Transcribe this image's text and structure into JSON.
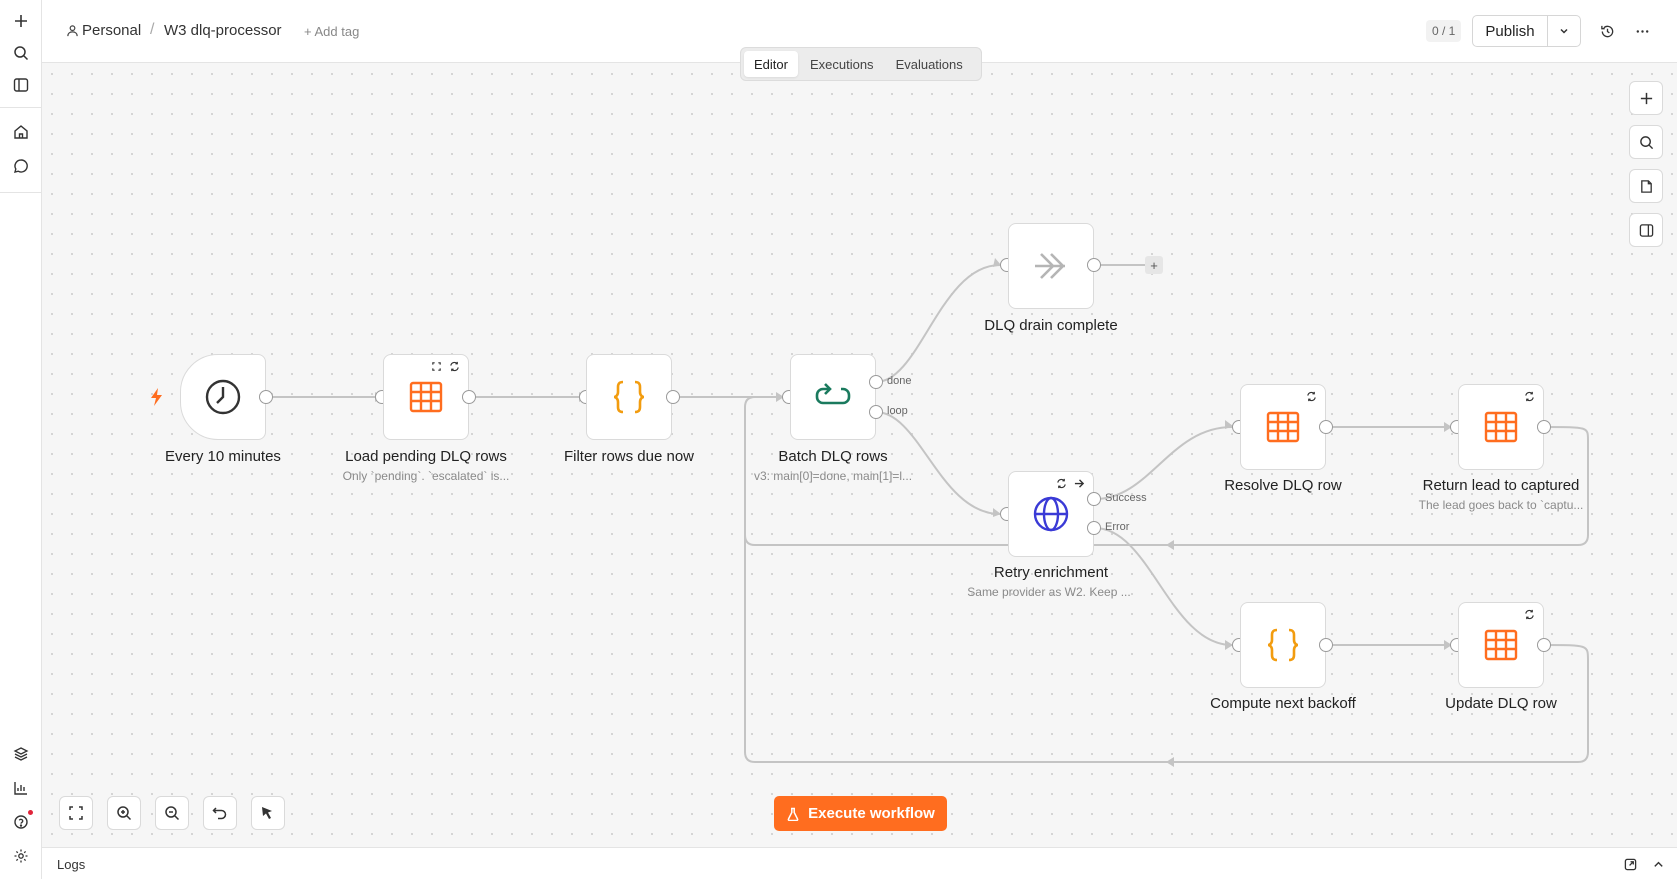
{
  "breadcrumb": {
    "project": "Personal",
    "workflow": "W3 dlq-processor",
    "add_tag": "+ Add tag"
  },
  "header": {
    "version_counter": "0 / 1",
    "publish_label": "Publish"
  },
  "tabs": [
    {
      "label": "Editor",
      "active": true
    },
    {
      "label": "Executions",
      "active": false
    },
    {
      "label": "Evaluations",
      "active": false
    }
  ],
  "nodes": {
    "trigger": {
      "title": "Every 10 minutes",
      "icon": "clock-icon"
    },
    "load": {
      "title": "Load pending DLQ rows",
      "subtitle": "Only `pending`. `escalated` is...",
      "icon": "table-icon"
    },
    "filter": {
      "title": "Filter rows due now",
      "icon": "code-braces-icon"
    },
    "batch": {
      "title": "Batch DLQ rows",
      "subtitle": "v3: main[0]=done, main[1]=l...",
      "icon": "loop-icon",
      "outputs": [
        "done",
        "loop"
      ]
    },
    "complete": {
      "title": "DLQ drain complete",
      "icon": "noop-arrow-icon"
    },
    "retry": {
      "title": "Retry enrichment",
      "subtitle": "Same provider as W2. Keep ...",
      "icon": "globe-icon",
      "outputs": [
        "Success",
        "Error"
      ]
    },
    "resolve": {
      "title": "Resolve DLQ row",
      "icon": "table-icon"
    },
    "return_lead": {
      "title": "Return lead to captured",
      "subtitle": "The lead goes back to `captu...",
      "icon": "table-icon"
    },
    "backoff": {
      "title": "Compute next backoff",
      "icon": "code-braces-icon"
    },
    "update": {
      "title": "Update DLQ row",
      "icon": "table-icon"
    }
  },
  "execute_button": {
    "label": "Execute workflow"
  },
  "logs": {
    "label": "Logs"
  },
  "colors": {
    "accent": "#ff6d1f",
    "table_icon": "#ff6d1f",
    "code_icon": "#f29c0f",
    "loop_icon": "#1a7a5e",
    "globe_icon": "#3a3ad6",
    "noop_icon": "#b5b5b5"
  }
}
